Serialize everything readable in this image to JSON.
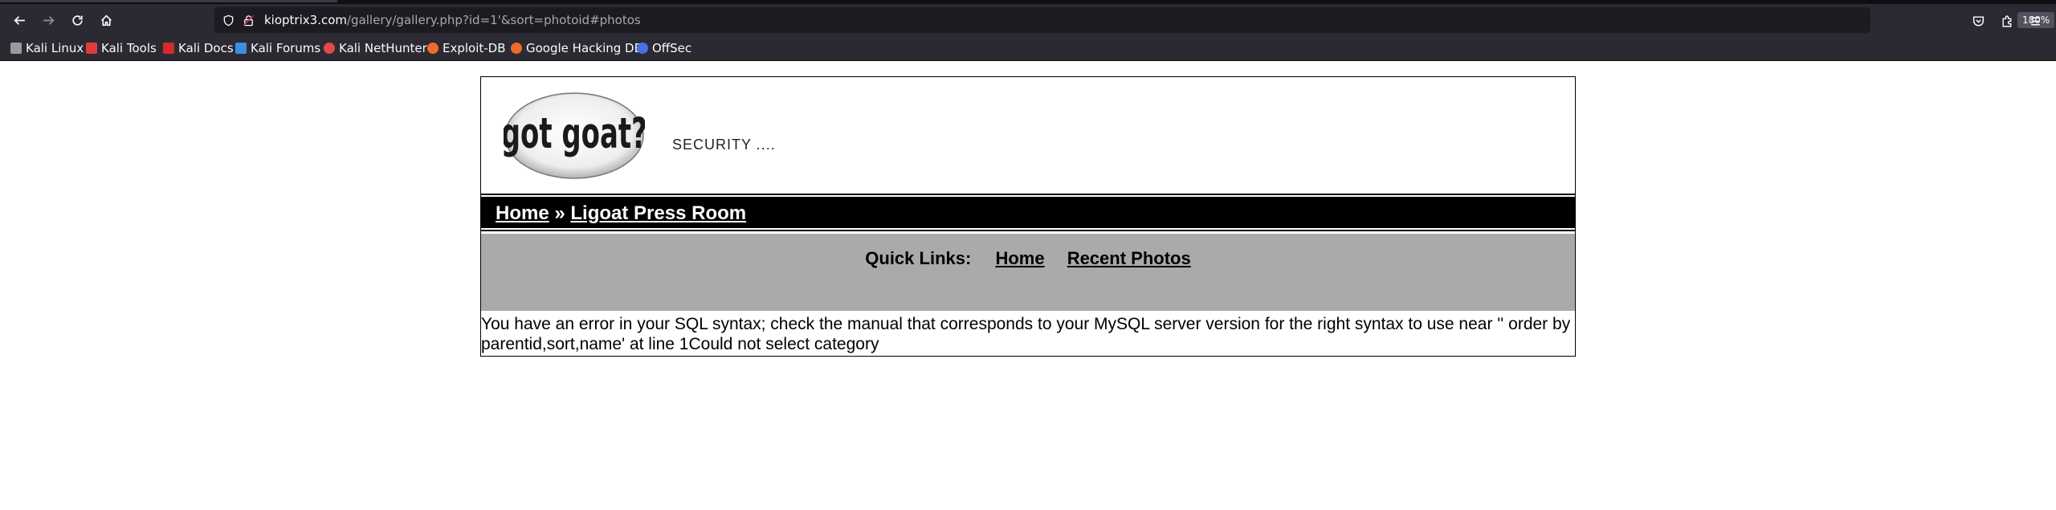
{
  "browser": {
    "url_host": "kioptrix3.com",
    "url_path": "/gallery/gallery.php?id=1'&sort=photoid#photos",
    "zoom": "180%",
    "bookmarks": [
      {
        "label": "Kali Linux",
        "icon": "kali-dragon-icon",
        "color": "#c8c8c8"
      },
      {
        "label": "Kali Tools",
        "icon": "kali-tools-icon",
        "color": "#e03b3b"
      },
      {
        "label": "Kali Docs",
        "icon": "kali-docs-icon",
        "color": "#d62b2b"
      },
      {
        "label": "Kali Forums",
        "icon": "kali-forums-icon",
        "color": "#3b8ee0"
      },
      {
        "label": "Kali NetHunter",
        "icon": "nethunter-icon",
        "color": "#e04a4a"
      },
      {
        "label": "Exploit-DB",
        "icon": "exploit-db-icon",
        "color": "#f06a2a"
      },
      {
        "label": "Google Hacking DB",
        "icon": "ghdb-icon",
        "color": "#f06a2a"
      },
      {
        "label": "OffSec",
        "icon": "offsec-icon",
        "color": "#4a6fe0"
      }
    ]
  },
  "site": {
    "logo_text": "got goat?",
    "tagline": "SECURITY ....",
    "breadcrumb": {
      "home": "Home",
      "separator": "»",
      "current": "Ligoat Press Room"
    },
    "quick_links": {
      "label": "Quick Links:",
      "home": "Home",
      "recent": "Recent Photos"
    },
    "error_message": "You have an error in your SQL syntax; check the manual that corresponds to your MySQL server version for the right syntax to use near '' order by parentid,sort,name' at line 1Could not select category"
  }
}
